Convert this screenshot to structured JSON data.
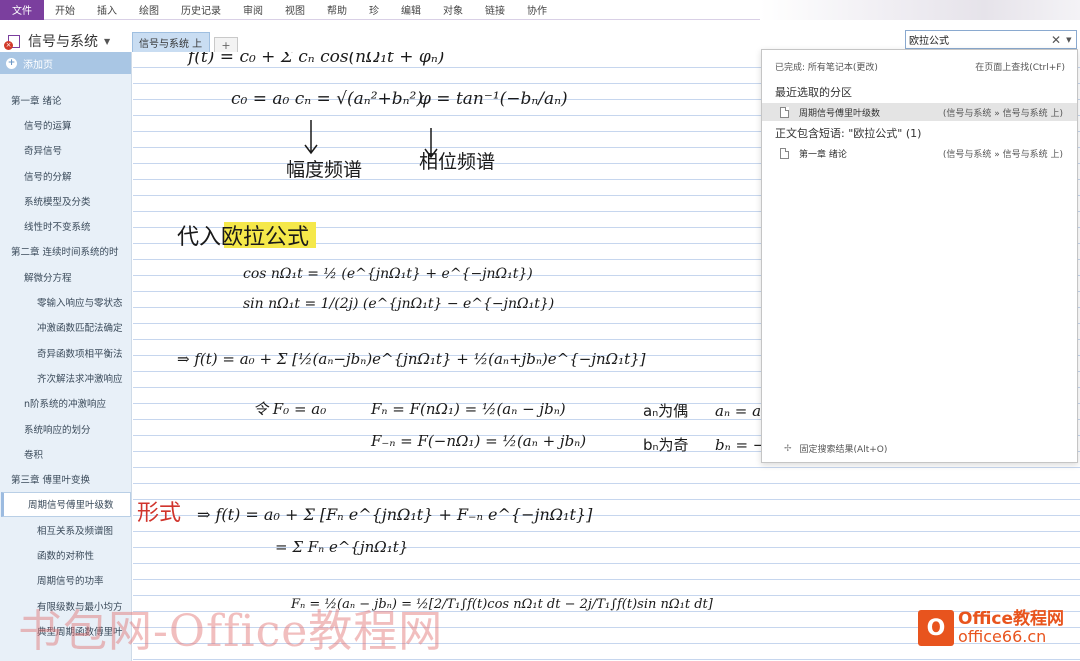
{
  "menu": {
    "file": "文件",
    "items": [
      "开始",
      "插入",
      "绘图",
      "历史记录",
      "审阅",
      "视图",
      "帮助",
      "珍",
      "编辑",
      "对象",
      "链接",
      "协作"
    ]
  },
  "notebook": {
    "name": "信号与系统",
    "section_tab": "信号与系统 上",
    "add_tab": "+"
  },
  "search": {
    "query": "欧拉公式"
  },
  "pagelist": {
    "add_page": "添加页",
    "pages": [
      {
        "label": "第一章 绪论",
        "level": 1
      },
      {
        "label": "信号的运算",
        "level": 2
      },
      {
        "label": "奇异信号",
        "level": 2
      },
      {
        "label": "信号的分解",
        "level": 2
      },
      {
        "label": "系统模型及分类",
        "level": 2
      },
      {
        "label": "线性时不变系统",
        "level": 2
      },
      {
        "label": "第二章 连续时间系统的时",
        "level": 1
      },
      {
        "label": "解微分方程",
        "level": 2
      },
      {
        "label": "零输入响应与零状态",
        "level": 3
      },
      {
        "label": "冲激函数匹配法确定",
        "level": 3
      },
      {
        "label": "奇异函数项相平衡法",
        "level": 3
      },
      {
        "label": "齐次解法求冲激响应",
        "level": 3
      },
      {
        "label": "n阶系统的冲激响应",
        "level": 2
      },
      {
        "label": "系统响应的划分",
        "level": 2
      },
      {
        "label": "卷积",
        "level": 2
      },
      {
        "label": "第三章 傅里叶变换",
        "level": 1
      },
      {
        "label": "周期信号傅里叶级数",
        "level": 2,
        "selected": true
      },
      {
        "label": "相互关系及频谱图",
        "level": 3
      },
      {
        "label": "函数的对称性",
        "level": 3
      },
      {
        "label": "周期信号的功率",
        "level": 3
      },
      {
        "label": "有限级数与最小均方",
        "level": 3
      },
      {
        "label": "典型周期函数傅里叶",
        "level": 3
      }
    ]
  },
  "results": {
    "status": "已完成: 所有笔记本(更改)",
    "find_on_page": "在页面上查找(Ctrl+F)",
    "recent_header": "最近选取的分区",
    "recent_item": {
      "label": "周期信号傅里叶级数",
      "location": "(信号与系统 » 信号与系统 上)"
    },
    "text_header": "正文包含短语: \"欧拉公式\" (1)",
    "text_item": {
      "label": "第一章 绪论",
      "location": "(信号与系统 » 信号与系统 上)"
    },
    "pin": "固定搜索结果(Alt+O)"
  },
  "note": {
    "heading": "代入欧拉公式",
    "side_label": "形式",
    "amp_label": "幅度频谱",
    "phase_label": "相位频谱",
    "even_label": "aₙ为偶",
    "odd_label": "bₙ为奇",
    "eq_c": "c₀ = a₀    cₙ = √(aₙ²+bₙ²)",
    "eq_phi": "φ = tan⁻¹(−bₙ/aₙ)",
    "eq_cos": "cos nΩ₁t = ½ (e^{jnΩ₁t} + e^{−jnΩ₁t})",
    "eq_sin": "sin nΩ₁t = 1/(2j) (e^{jnΩ₁t} − e^{−jnΩ₁t})",
    "eq_f": "⇒ f(t) = a₀ + Σ [½(aₙ−jbₙ)e^{jnΩ₁t} + ½(aₙ+jbₙ)e^{−jnΩ₁t}]",
    "eq_F0": "令 F₀ = a₀",
    "eq_Fn": "Fₙ = F(nΩ₁) = ½(aₙ − jbₙ)",
    "eq_Fmn": "F₋ₙ = F(−nΩ₁) = ½(aₙ + jbₙ)",
    "eq_an": "aₙ = a₋ₙ",
    "eq_bn": "bₙ = −b₋ₙ",
    "eq_exp": "⇒ f(t) = a₀ + Σ [Fₙ e^{jnΩ₁t} + F₋ₙ e^{−jnΩ₁t}]",
    "eq_exp2": "= Σ Fₙ e^{jnΩ₁t}",
    "eq_Fint": "Fₙ = ½(aₙ − jbₙ) = ½[2/T₁∫f(t)cos nΩ₁t dt − 2j/T₁∫f(t)sin nΩ₁t dt]",
    "eq_top": "f(t) = c₀ + Σ cₙ cos(nΩ₁t + φₙ)"
  },
  "watermark": {
    "text": "书包网-Office教程网",
    "logo_mark": "O",
    "logo_line1": "Office教程网",
    "logo_line2": "office66.cn"
  },
  "colors": {
    "accent": "#7b3f9e",
    "tab": "#c9ddf2",
    "pagelist": "#e8f0f8",
    "highlight": "#f5e84a",
    "red_ink": "#d0342c"
  }
}
